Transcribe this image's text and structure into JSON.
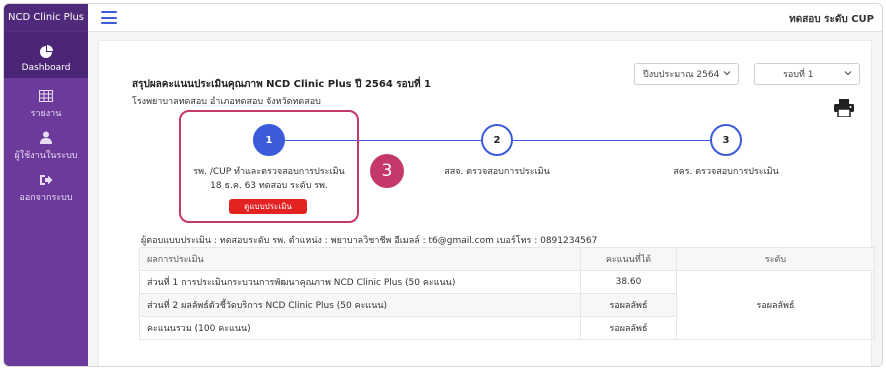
{
  "app": {
    "brand": "NCD Clinic Plus",
    "user_label": "ทดสอบ ระดับ CUP"
  },
  "sidebar": {
    "items": [
      {
        "label": "Dashboard",
        "icon": "pie-chart-icon"
      },
      {
        "label": "รายงาน",
        "icon": "table-icon"
      },
      {
        "label": "ผู้ใช้งานในระบบ",
        "icon": "user-icon"
      },
      {
        "label": "ออกจากระบบ",
        "icon": "sign-out-icon"
      }
    ]
  },
  "header": {
    "title": "สรุปผลคะแนนประเมินคุณภาพ NCD Clinic Plus ปี 2564 รอบที่ 1",
    "subtitle": "โรงพยาบาลทดสอบ อำเภอทดสอบ จังหวัดทดสอบ"
  },
  "filters": {
    "year": "ปีงบประมาณ 2564",
    "round": "รอบที่ 1"
  },
  "steps": [
    {
      "number": "1",
      "label": "รพ. /CUP ทำและตรวจสอบการประเมิน",
      "sub": "18 ธ.ค. 63 ทดสอบ ระดับ รพ.",
      "button": "ดูแบบประเมิน"
    },
    {
      "number": "2",
      "label": "สสจ. ตรวจสอบการประเมิน"
    },
    {
      "number": "3",
      "label": "สคร. ตรวจสอบการประเมิน"
    }
  ],
  "annotation_badge": "3",
  "evaluator": "ผู้ตอบแบบประเมิน : ทดสอบระดับ รพ. ตำแหน่ง : พยาบาลวิชาชีพ อีเมลล์ : t6@gmail.com เบอร์โทร : 0891234567",
  "table": {
    "headers": [
      "ผลการประเมิน",
      "คะแนนที่ได้",
      "ระดับ"
    ],
    "rows": [
      {
        "item": "ส่วนที่ 1 การประเมินกระบวนการพัฒนาคุณภาพ NCD Clinic Plus (50 คะแนน)",
        "score": "38.60"
      },
      {
        "item": "ส่วนที่ 2 ผลลัพธ์ตัวชี้วัดบริการ NCD Clinic Plus (50 คะแนน)",
        "score": "รอผลลัพธ์"
      },
      {
        "item": "คะแนนรวม (100 คะแนน)",
        "score": "รอผลลัพธ์"
      }
    ],
    "level": "รอผลลัพธ์"
  },
  "colors": {
    "sidebar": "#6b3a9b",
    "accent": "#3b5bdb",
    "highlight": "#c5386b",
    "button": "#e32222"
  }
}
